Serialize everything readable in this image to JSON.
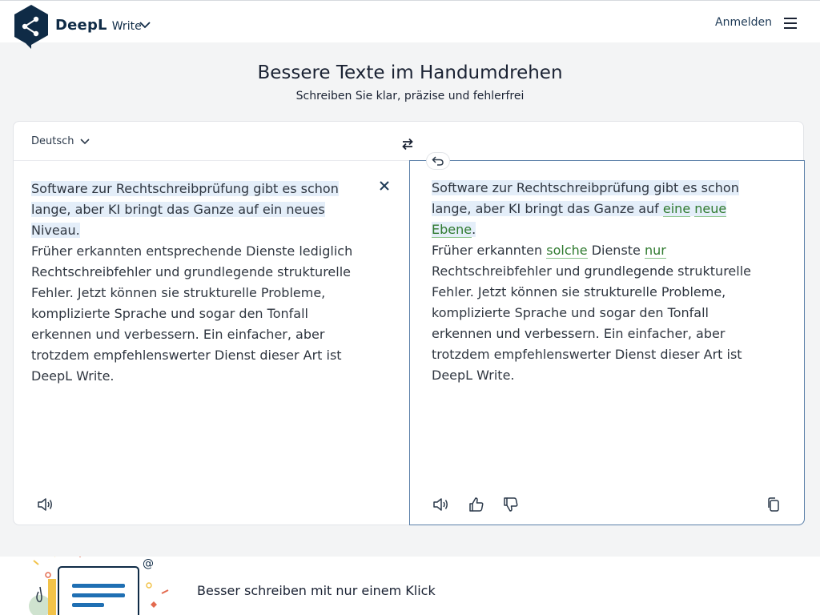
{
  "header": {
    "brand_name": "DeepL",
    "brand_product": "Write",
    "login_label": "Anmelden",
    "icons": {
      "logo": "deepl-logo",
      "chevron": "chevron-down-icon",
      "menu": "hamburger-menu-icon"
    }
  },
  "hero": {
    "title": "Bessere Texte im Handumdrehen",
    "subtitle": "Schreiben Sie klar, präzise und fehlerfrei"
  },
  "editor": {
    "language": "Deutsch",
    "source": {
      "highlight_lines": [
        "Software zur Rechtschreibprüfung gibt es schon",
        "lange, aber KI bringt das Ganze auf ein neues Niveau."
      ],
      "rest": "Früher erkannten entsprechende Dienste lediglich Rechtschreibfehler und grundlegende strukturelle Fehler. Jetzt können sie strukturelle Probleme, komplizierte Sprache und sogar den Tonfall erkennen und verbessern. Ein einfacher, aber trotzdem empfehlenswerter Dienst dieser Art ist DeepL Write."
    },
    "result": {
      "hl_line1": "Software zur Rechtschreibprüfung gibt es schon",
      "hl_line2_prefix": "lange, aber KI bringt das Ganze auf ",
      "ch_eine": "eine",
      "ch_neue": "neue",
      "ch_ebene": "Ebene",
      "hl_line2_suffix": ".",
      "l3_prefix": "Früher erkannten ",
      "ch_solche": "solche",
      "l3_mid": " Dienste ",
      "ch_nur": "nur",
      "rest": "Rechtschreibfehler und grundlegende strukturelle Fehler. Jetzt können sie strukturelle Probleme, komplizierte Sprache und sogar den Tonfall erkennen und verbessern. Ein einfacher, aber trotzdem empfehlenswerter Dienst dieser Art ist DeepL Write."
    },
    "icons": [
      "swap-icon",
      "close-icon",
      "undo-icon",
      "speaker-icon",
      "thumbs-up-icon",
      "thumbs-down-icon",
      "copy-icon"
    ]
  },
  "footer": {
    "tagline": "Besser schreiben mit nur einem Klick"
  },
  "colors": {
    "brand": "#0f2b46",
    "highlight": "#e4eef9",
    "change": "#2f7a2f",
    "active_border": "#5a7fa8"
  }
}
